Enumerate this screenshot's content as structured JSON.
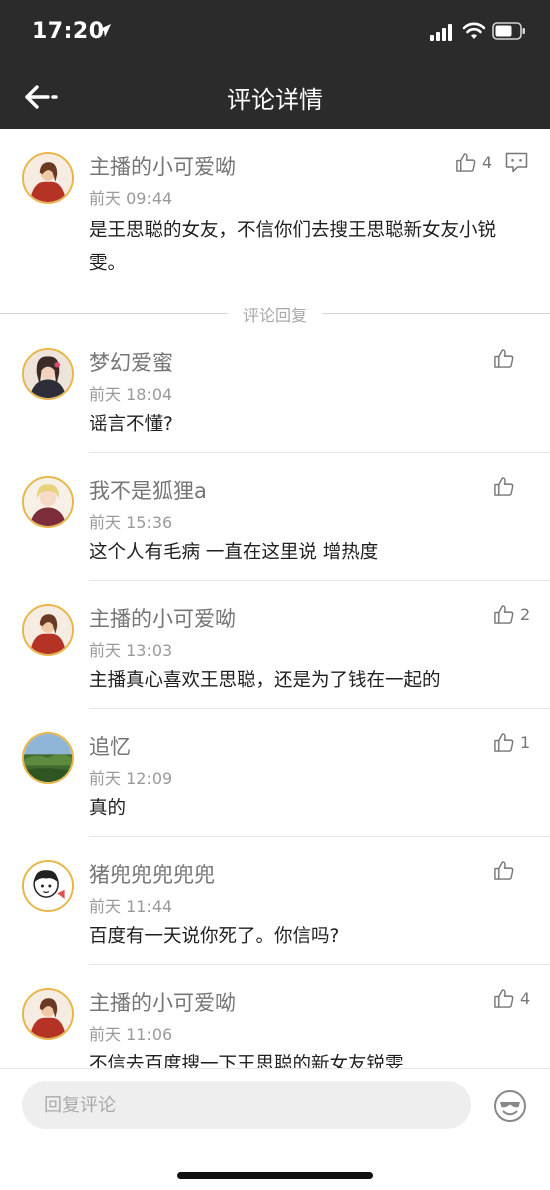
{
  "status_bar": {
    "time": "17:20"
  },
  "header": {
    "title": "评论详情"
  },
  "main_comment": {
    "username": "主播的小可爱呦",
    "time": "前天 09:44",
    "text": "是王思聪的女友，不信你们去搜王思聪新女友小锐雯。",
    "likes": "4"
  },
  "divider_label": "评论回复",
  "replies": [
    {
      "username": "梦幻爱蜜",
      "time": "前天 18:04",
      "text": "谣言不懂?",
      "likes": ""
    },
    {
      "username": "我不是狐狸a",
      "time": "前天 15:36",
      "text": "这个人有毛病 一直在这里说 增热度",
      "likes": ""
    },
    {
      "username": "主播的小可爱呦",
      "time": "前天 13:03",
      "text": "主播真心喜欢王思聪，还是为了钱在一起的",
      "likes": "2"
    },
    {
      "username": "追忆",
      "time": "前天 12:09",
      "text": "真的",
      "likes": "1"
    },
    {
      "username": "猪兜兜兜兜兜",
      "time": "前天 11:44",
      "text": "百度有一天说你死了。你信吗?",
      "likes": ""
    },
    {
      "username": "主播的小可爱呦",
      "time": "前天 11:06",
      "text": "不信去百度搜一下王思聪的新女友锐雯",
      "likes": "4"
    }
  ],
  "reply_bar": {
    "placeholder": "回复评论"
  },
  "icons": {
    "back": "back-arrow-icon",
    "like": "thumbs-up-icon",
    "reply": "reply-bubble-icon",
    "emoji": "emoji-face-icon",
    "location": "location-arrow-icon",
    "signal": "signal-icon",
    "wifi": "wifi-icon",
    "battery": "battery-icon"
  },
  "colors": {
    "header_bg": "#2b2b2b",
    "avatar_border": "#e7b64b",
    "username": "#757575",
    "secondary": "#9a9a9a"
  }
}
